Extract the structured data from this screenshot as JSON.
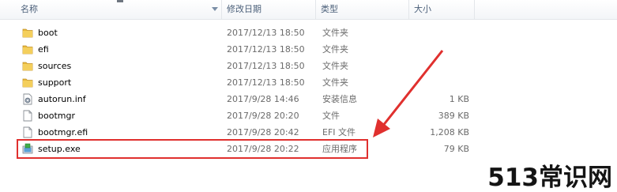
{
  "columns": {
    "name": "名称",
    "date": "修改日期",
    "type": "类型",
    "size": "大小"
  },
  "files": [
    {
      "name": "boot",
      "date": "2017/12/13 18:50",
      "type": "文件夹",
      "size": "",
      "icon": "folder-icon"
    },
    {
      "name": "efi",
      "date": "2017/12/13 18:50",
      "type": "文件夹",
      "size": "",
      "icon": "folder-icon"
    },
    {
      "name": "sources",
      "date": "2017/12/13 18:50",
      "type": "文件夹",
      "size": "",
      "icon": "folder-icon"
    },
    {
      "name": "support",
      "date": "2017/12/13 18:50",
      "type": "文件夹",
      "size": "",
      "icon": "folder-icon"
    },
    {
      "name": "autorun.inf",
      "date": "2017/9/28 14:46",
      "type": "安装信息",
      "size": "1 KB",
      "icon": "settings-file-icon"
    },
    {
      "name": "bootmgr",
      "date": "2017/9/28 20:20",
      "type": "文件",
      "size": "389 KB",
      "icon": "file-icon"
    },
    {
      "name": "bootmgr.efi",
      "date": "2017/9/28 20:42",
      "type": "EFI 文件",
      "size": "1,208 KB",
      "icon": "file-icon"
    },
    {
      "name": "setup.exe",
      "date": "2017/9/28 20:22",
      "type": "应用程序",
      "size": "79 KB",
      "icon": "setup-exe-icon"
    }
  ],
  "watermark": "513常识网",
  "colors": {
    "highlight": "#e0302e",
    "folder": "#e8b93a",
    "header_text": "#4c607a"
  }
}
